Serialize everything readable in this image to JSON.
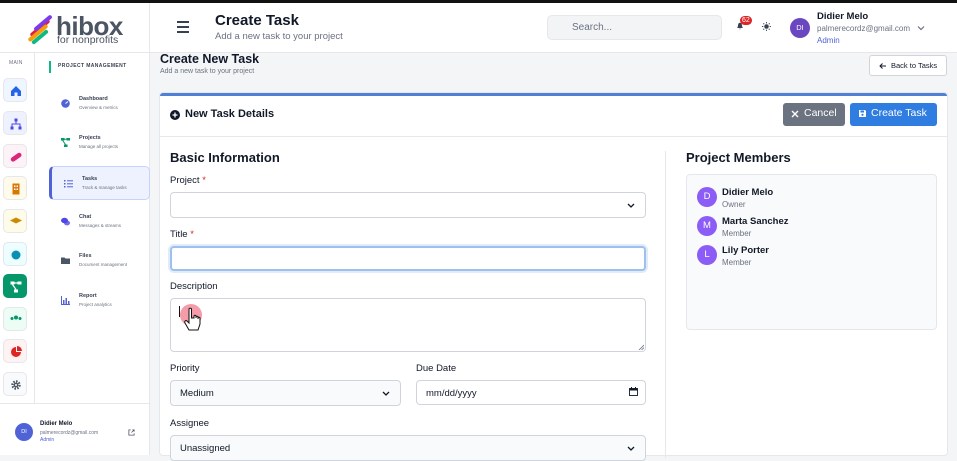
{
  "brand": {
    "name": "hibox",
    "tagline": "for nonprofits"
  },
  "header": {
    "title": "Create Task",
    "subtitle": "Add a new task to your project",
    "search_placeholder": "Search...",
    "notification_count": "62",
    "user": {
      "initials": "DI",
      "name": "Didier Melo",
      "email": "palmerecordz@gmail.com",
      "role": "Admin"
    }
  },
  "rail": {
    "label": "MAIN",
    "items": [
      {
        "icon": "home-icon",
        "color": "#2563eb",
        "bg": "#eff6ff"
      },
      {
        "icon": "sitemap-icon",
        "color": "#4f46e5",
        "bg": "#eef2ff"
      },
      {
        "icon": "bandage-icon",
        "color": "#db2777",
        "bg": "#fdf2f8"
      },
      {
        "icon": "building-icon",
        "color": "#d97706",
        "bg": "#fffbeb"
      },
      {
        "icon": "graduation-cap-icon",
        "color": "#ca8a04",
        "bg": "#fefce8"
      },
      {
        "icon": "circle-icon",
        "color": "#0891b2",
        "bg": "#ecfeff"
      },
      {
        "icon": "project-diagram-icon",
        "color": "#ffffff",
        "bg": "#059669"
      },
      {
        "icon": "users-icon",
        "color": "#059669",
        "bg": "#ecfdf5"
      },
      {
        "icon": "pie-chart-icon",
        "color": "#dc2626",
        "bg": "#fef2f2"
      },
      {
        "icon": "gear-icon",
        "color": "#4b5563",
        "bg": "#f9fafb"
      }
    ]
  },
  "nav": {
    "heading": "PROJECT MANAGEMENT",
    "items": [
      {
        "title": "Dashboard",
        "desc": "Overview & metrics",
        "icon": "dashboard-icon",
        "color": "#4f63d6"
      },
      {
        "title": "Projects",
        "desc": "Manage all projects",
        "icon": "project-diagram-icon",
        "color": "#059669"
      },
      {
        "title": "Tasks",
        "desc": "Track & manage tasks",
        "icon": "tasks-icon",
        "color": "#4f63d6"
      },
      {
        "title": "Chat",
        "desc": "Messages & streams",
        "icon": "chat-icon",
        "color": "#4f46e5"
      },
      {
        "title": "Files",
        "desc": "Document management",
        "icon": "folder-icon",
        "color": "#4b5563"
      },
      {
        "title": "Report",
        "desc": "Project analytics",
        "icon": "chart-bar-icon",
        "color": "#4f63d6"
      }
    ],
    "footer": {
      "initials": "DI",
      "name": "Didier Melo",
      "email": "palmerecordz@gmail.com",
      "role": "Admin"
    }
  },
  "main": {
    "title": "Create New Task",
    "subtitle": "Add a new task to your project",
    "back_label": "Back to Tasks"
  },
  "card": {
    "title": "New Task Details",
    "cancel_label": "Cancel",
    "create_label": "Create Task"
  },
  "form": {
    "section_title": "Basic Information",
    "project_label": "Project",
    "project_value": "",
    "title_label": "Title",
    "title_value": "",
    "description_label": "Description",
    "description_value": "",
    "priority_label": "Priority",
    "priority_value": "Medium",
    "due_date_label": "Due Date",
    "due_date_value": "mm/dd/yyyy",
    "assignee_label": "Assignee",
    "assignee_value": "Unassigned",
    "required_mark": "*"
  },
  "members": {
    "section_title": "Project Members",
    "list": [
      {
        "initial": "D",
        "name": "Didier Melo",
        "role": "Owner"
      },
      {
        "initial": "M",
        "name": "Marta Sanchez",
        "role": "Member"
      },
      {
        "initial": "L",
        "name": "Lily Porter",
        "role": "Member"
      }
    ]
  },
  "colors": {
    "accent": "#2f7de1",
    "brand_accent": "#4f63d6",
    "cancel": "#6b7280",
    "required": "#dc2626"
  }
}
